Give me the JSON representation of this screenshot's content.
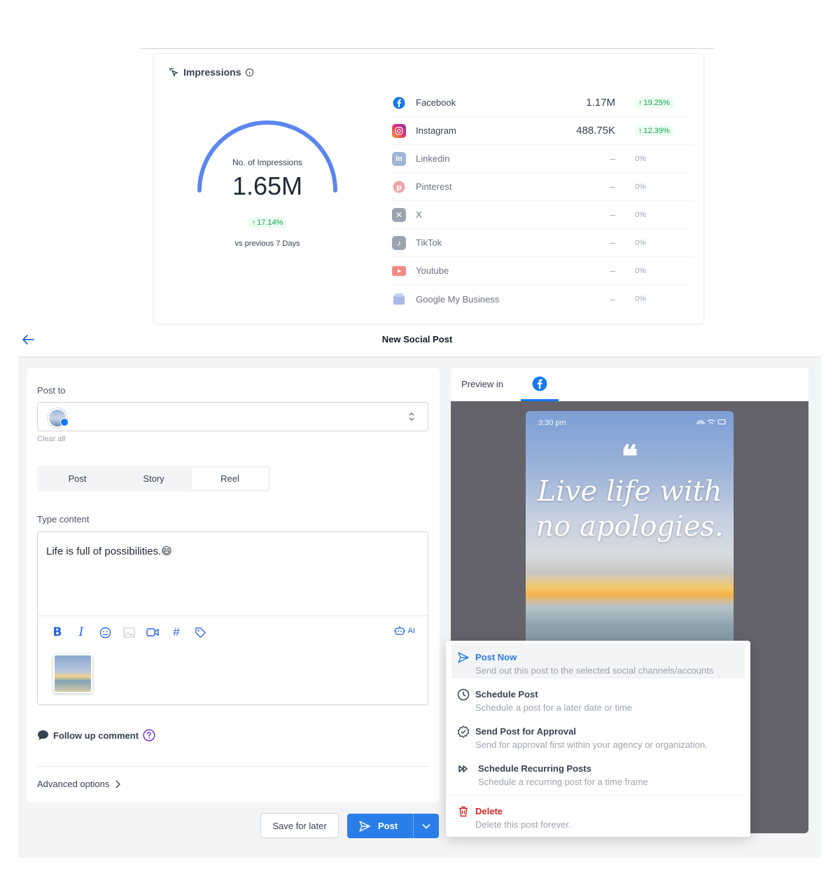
{
  "impressions": {
    "title": "Impressions",
    "gauge_label": "No. of Impressions",
    "total": "1.65M",
    "delta": "17.14%",
    "comparison": "vs previous 7 Days",
    "platforms": [
      {
        "name": "Facebook",
        "value": "1.17M",
        "delta": "19.25%",
        "active": true,
        "icon": "facebook-icon"
      },
      {
        "name": "Instagram",
        "value": "488.75K",
        "delta": "12.39%",
        "active": true,
        "icon": "instagram-icon"
      },
      {
        "name": "Linkedin",
        "value": "–",
        "delta": "0%",
        "active": false,
        "icon": "linkedin-icon"
      },
      {
        "name": "Pinterest",
        "value": "–",
        "delta": "0%",
        "active": false,
        "icon": "pinterest-icon"
      },
      {
        "name": "X",
        "value": "–",
        "delta": "0%",
        "active": false,
        "icon": "x-icon"
      },
      {
        "name": "TikTok",
        "value": "–",
        "delta": "0%",
        "active": false,
        "icon": "tiktok-icon"
      },
      {
        "name": "Youtube",
        "value": "–",
        "delta": "0%",
        "active": false,
        "icon": "youtube-icon"
      },
      {
        "name": "Google My Business",
        "value": "–",
        "delta": "0%",
        "active": false,
        "icon": "google-business-icon"
      }
    ]
  },
  "header": {
    "title": "New Social Post"
  },
  "composer": {
    "post_to_label": "Post to",
    "clear_all": "Clear all",
    "types": [
      "Post",
      "Story",
      "Reel"
    ],
    "active_type": "Reel",
    "type_content_label": "Type content",
    "content": "Life is full of possibilities.😄",
    "ai_label": "AI",
    "follow_up": "Follow up comment",
    "advanced": "Advanced options"
  },
  "preview": {
    "label": "Preview in",
    "time": "3:30 pm",
    "quote_line1": "Live life with",
    "quote_line2": "no apologies."
  },
  "menu": [
    {
      "title": "Post Now",
      "desc": "Send out this post to the selected social channels/accounts"
    },
    {
      "title": "Schedule Post",
      "desc": "Schedule a post for a later date or time"
    },
    {
      "title": "Send Post for Approval",
      "desc": "Send for approval first within your agency or organization."
    },
    {
      "title": "Schedule Recurring Posts",
      "desc": "Schedule a recurring post for a time frame"
    },
    {
      "title": "Delete",
      "desc": "Delete this post forever."
    }
  ],
  "actions": {
    "save_later": "Save for later",
    "post": "Post"
  },
  "colors": {
    "accent": "#2b7de9",
    "facebook": "#1877f2",
    "danger": "#dc2626",
    "positive": "#16a34a"
  }
}
